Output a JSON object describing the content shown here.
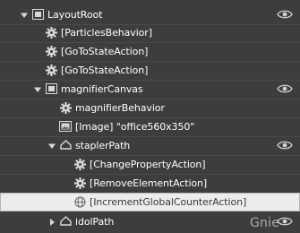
{
  "tree": {
    "layout_root": {
      "label": "LayoutRoot"
    },
    "particles_behavior": {
      "label": "[ParticlesBehavior]"
    },
    "go_to_state_action_1": {
      "label": "[GoToStateAction]"
    },
    "go_to_state_action_2": {
      "label": "[GoToStateAction]"
    },
    "magnifier_canvas": {
      "label": "magnifierCanvas"
    },
    "magnifier_behavior": {
      "label": "magnifierBehavior"
    },
    "image_office": {
      "label": "[Image] \"office560x350\""
    },
    "stapler_path": {
      "label": "staplerPath"
    },
    "change_property_action": {
      "label": "[ChangePropertyAction]"
    },
    "remove_element_action": {
      "label": "[RemoveElementAction]"
    },
    "increment_global_counter_action": {
      "label": "[IncrementGlobalCounterAction]"
    },
    "idol_path": {
      "label": "idolPath"
    }
  },
  "watermark": {
    "text": "Gnie"
  },
  "colors": {
    "background": "#3d3d3d",
    "text": "#ffffff",
    "selected_background": "#ececec",
    "selected_text": "#3a3a3a",
    "icon": "#d8d8d8"
  },
  "icons": {
    "layout_root": "grid-container-icon",
    "behavior": "gear-icon",
    "action": "gear-icon",
    "canvas": "grid-container-icon",
    "image": "image-icon",
    "path": "path-shape-icon",
    "global_action": "globe-icon",
    "visibility": "eye-icon",
    "expanded": "expanded-triangle-icon",
    "collapsed": "collapsed-triangle-icon"
  }
}
